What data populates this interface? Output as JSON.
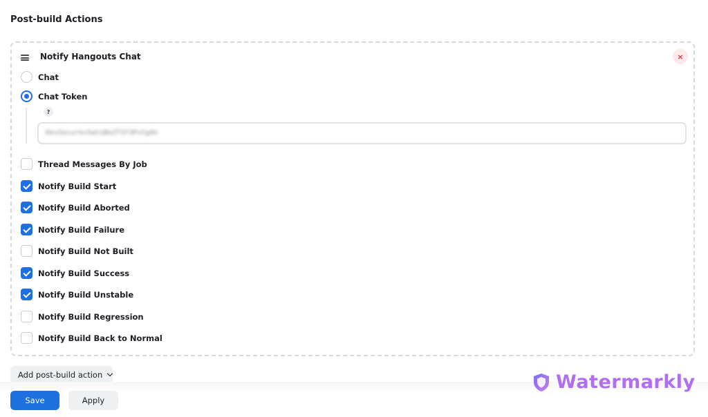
{
  "section": {
    "title": "Post-build Actions"
  },
  "card": {
    "title": "Notify Hangouts Chat",
    "close_icon": "×",
    "radios": [
      {
        "label": "Chat",
        "selected": false
      },
      {
        "label": "Chat Token",
        "selected": true
      }
    ],
    "help_label": "?",
    "token_value": "DevSecurechatsBo2T3f3Pvtg4n",
    "checkboxes": [
      {
        "label": "Thread Messages By Job",
        "checked": false
      },
      {
        "label": "Notify Build Start",
        "checked": true
      },
      {
        "label": "Notify Build Aborted",
        "checked": true
      },
      {
        "label": "Notify Build Failure",
        "checked": true
      },
      {
        "label": "Notify Build Not Built",
        "checked": false
      },
      {
        "label": "Notify Build Success",
        "checked": true
      },
      {
        "label": "Notify Build Unstable",
        "checked": true
      },
      {
        "label": "Notify Build Regression",
        "checked": false
      },
      {
        "label": "Notify Build Back to Normal",
        "checked": false
      }
    ]
  },
  "add_action": {
    "label": "Add post-build action",
    "icon": "chevron-down-icon"
  },
  "footer": {
    "save_label": "Save",
    "apply_label": "Apply"
  },
  "watermark": {
    "text": "Watermarkly",
    "icon": "shield-icon"
  },
  "colors": {
    "accent": "#1e6fe0",
    "danger": "#e0334f",
    "watermark": "#b06ff0"
  }
}
